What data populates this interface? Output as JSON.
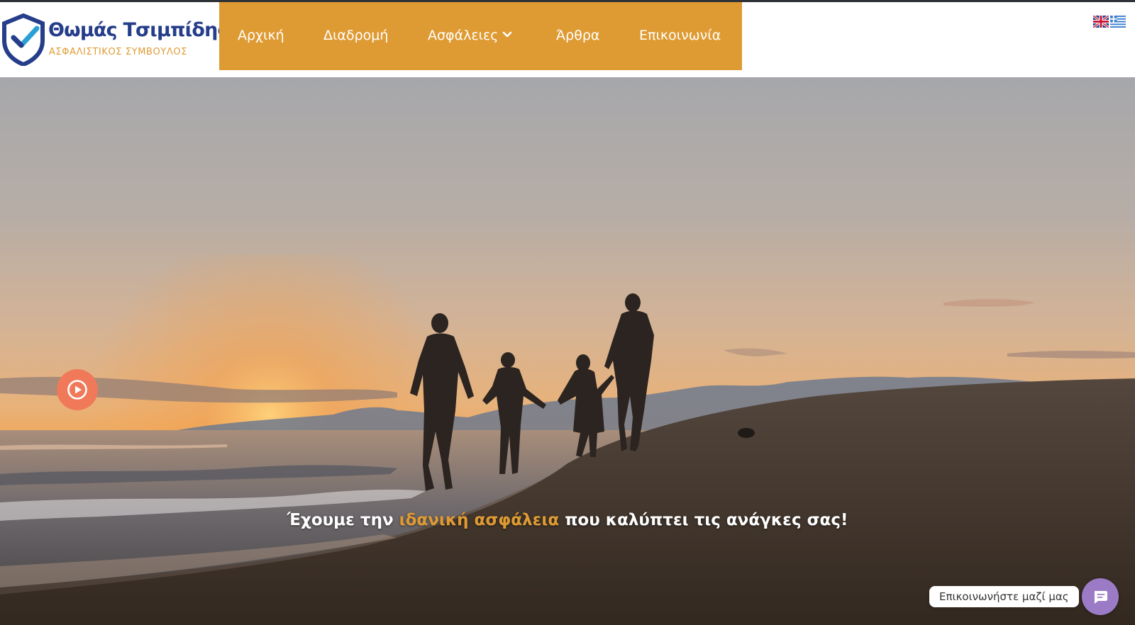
{
  "brand": {
    "name": "Θωμάς Τσιμπίδης",
    "subtitle": "ΑΣΦΑΛΙΣΤΙΚΟΣ ΣΥΜΒΟΥΛΟΣ",
    "colors": {
      "navy": "#253d8a",
      "orange": "#df9b33"
    },
    "logo_icon": "shield-check-icon"
  },
  "nav": {
    "items": [
      {
        "label": "Αρχική"
      },
      {
        "label": "Διαδρομή"
      },
      {
        "label": "Ασφάλειες",
        "icon": "chevron-down-icon"
      },
      {
        "label": "Άρθρα"
      },
      {
        "label": "Επικοινωνία"
      }
    ]
  },
  "languages": [
    {
      "icon": "uk-flag-icon"
    },
    {
      "icon": "greek-flag-icon"
    }
  ],
  "hero": {
    "tagline_start": "Έχουμε την ",
    "tagline_highlight": "ιδανική ασφάλεια",
    "tagline_end": " που καλύπτει τις ανάγκες σας!",
    "play_icon": "play-icon"
  },
  "contact_widget": {
    "label": "Επικοινωνήστε μαζί μας",
    "icon": "chat-icon",
    "color": "#9c7bc6"
  }
}
